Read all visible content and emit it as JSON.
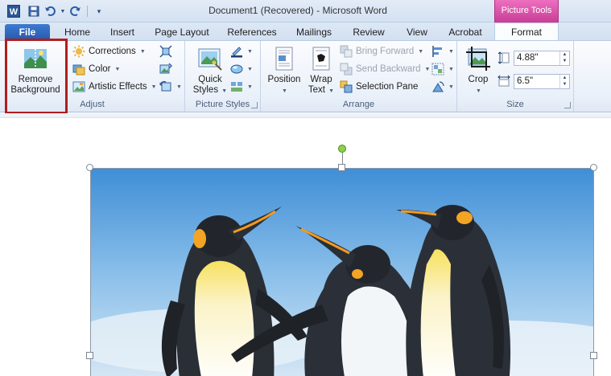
{
  "app": {
    "window_title": "Document1 (Recovered)  -  Microsoft Word",
    "icon_letter": "W"
  },
  "context_tab": {
    "label": "Picture Tools"
  },
  "tabs": [
    {
      "label": "File"
    },
    {
      "label": "Home"
    },
    {
      "label": "Insert"
    },
    {
      "label": "Page Layout"
    },
    {
      "label": "References"
    },
    {
      "label": "Mailings"
    },
    {
      "label": "Review"
    },
    {
      "label": "View"
    },
    {
      "label": "Acrobat"
    },
    {
      "label": "Format"
    }
  ],
  "ribbon": {
    "adjust": {
      "label": "Adjust",
      "remove_background_line1": "Remove",
      "remove_background_line2": "Background",
      "corrections": "Corrections",
      "color": "Color",
      "artistic_effects": "Artistic Effects"
    },
    "picture_styles": {
      "label": "Picture Styles",
      "quick_styles_line1": "Quick",
      "quick_styles_line2": "Styles"
    },
    "arrange": {
      "label": "Arrange",
      "position": "Position",
      "wrap_text_line1": "Wrap",
      "wrap_text_line2": "Text",
      "bring_forward": "Bring Forward",
      "send_backward": "Send Backward",
      "selection_pane": "Selection Pane"
    },
    "size": {
      "label": "Size",
      "crop": "Crop",
      "height_value": "4.88\"",
      "width_value": "6.5\""
    }
  },
  "colors": {
    "file_tab": "#2b5ebd",
    "context_pink": "#d94aa6",
    "highlight_red": "#b01e1e"
  }
}
